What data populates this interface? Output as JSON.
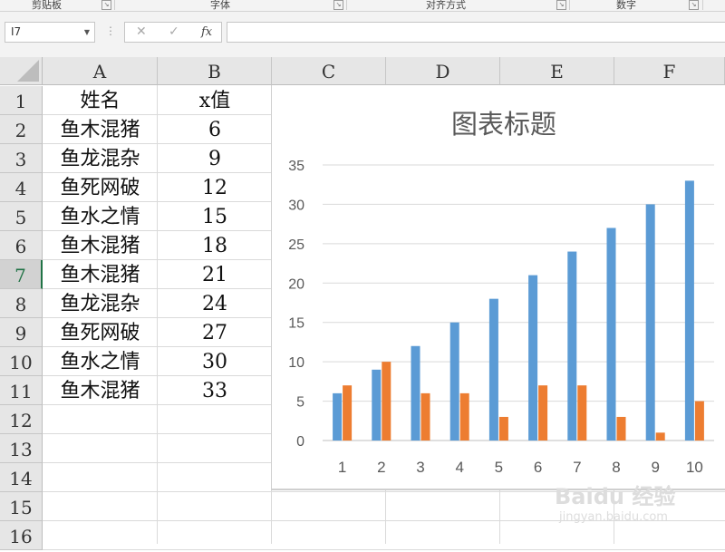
{
  "ribbon": {
    "groups": [
      "剪贴板",
      "字体",
      "对齐方式",
      "数字"
    ]
  },
  "formula_bar": {
    "name_box": "I7",
    "cancel_icon": "✕",
    "enter_icon": "✓",
    "fx_label": "fx",
    "formula": ""
  },
  "columns": [
    "A",
    "B",
    "C",
    "D",
    "E",
    "F"
  ],
  "rows": [
    "1",
    "2",
    "3",
    "4",
    "5",
    "6",
    "7",
    "8",
    "9",
    "10",
    "11",
    "12",
    "13",
    "14",
    "15",
    "16"
  ],
  "selected_row": "7",
  "sheet": {
    "header": [
      "姓名",
      "x值"
    ],
    "data": [
      [
        "鱼木混猪",
        "6"
      ],
      [
        "鱼龙混杂",
        "9"
      ],
      [
        "鱼死网破",
        "12"
      ],
      [
        "鱼水之情",
        "15"
      ],
      [
        "鱼木混猪",
        "18"
      ],
      [
        "鱼木混猪",
        "21"
      ],
      [
        "鱼龙混杂",
        "24"
      ],
      [
        "鱼死网破",
        "27"
      ],
      [
        "鱼水之情",
        "30"
      ],
      [
        "鱼木混猪",
        "33"
      ]
    ]
  },
  "colors": {
    "series1": "#5b9bd5",
    "series2": "#ed7d31",
    "header_bg": "#e6e6e6",
    "selection": "#217346"
  },
  "chart_data": {
    "type": "bar",
    "title": "图表标题",
    "categories": [
      "1",
      "2",
      "3",
      "4",
      "5",
      "6",
      "7",
      "8",
      "9",
      "10"
    ],
    "series": [
      {
        "values": [
          6,
          9,
          12,
          15,
          18,
          21,
          24,
          27,
          30,
          33
        ]
      },
      {
        "values": [
          7,
          10,
          6,
          6,
          3,
          7,
          7,
          3,
          1,
          5
        ]
      }
    ],
    "ylim": [
      0,
      35
    ],
    "yticks": [
      0,
      5,
      10,
      15,
      20,
      25,
      30,
      35
    ],
    "grid": true,
    "legend": "none"
  },
  "watermark": {
    "brand": "Baidu 经验",
    "url": "jingyan.baidu.com"
  }
}
